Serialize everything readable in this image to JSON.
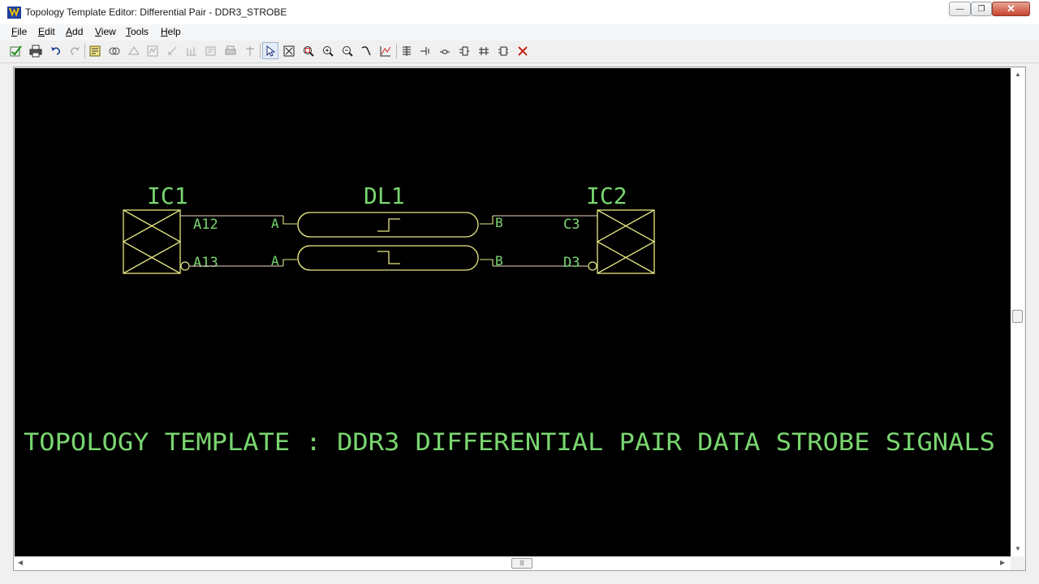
{
  "window": {
    "title": "Topology Template Editor: Differential Pair - DDR3_STROBE",
    "minimize_glyph": "—",
    "restore_glyph": "❐",
    "close_glyph": "✕"
  },
  "menu": {
    "file": {
      "accel": "F",
      "rest": "ile"
    },
    "edit": {
      "accel": "E",
      "rest": "dit"
    },
    "add": {
      "accel": "A",
      "rest": "dd"
    },
    "view": {
      "accel": "V",
      "rest": "iew"
    },
    "tools": {
      "accel": "T",
      "rest": "ools"
    },
    "help": {
      "accel": "H",
      "rest": "elp"
    }
  },
  "toolbar": {
    "icons": [
      "check-net-icon",
      "print-icon",
      "undo-icon",
      "redo-icon",
      "properties-icon",
      "compare-icon",
      "export-icon",
      "waveform-icon",
      "measure-icon",
      "report-icon",
      "print-setup-icon",
      "pin-icon",
      "select-pointer-icon",
      "zoom-fit-icon",
      "zoom-window-icon",
      "zoom-in-icon",
      "zoom-out-icon",
      "wire-tool-icon",
      "graph-icon",
      "add-pin-icon",
      "add-terminator-icon",
      "add-line-icon",
      "add-connector-icon",
      "add-coupled-icon",
      "add-diff-pair-icon",
      "delete-icon"
    ]
  },
  "schematic": {
    "components": {
      "ic1": {
        "ref": "IC1",
        "pins": [
          "A12",
          "A13"
        ]
      },
      "dl1": {
        "ref": "DL1",
        "port_in": [
          "A",
          "A"
        ],
        "port_out": [
          "B",
          "B"
        ]
      },
      "ic2": {
        "ref": "IC2",
        "pins": [
          "C3",
          "D3"
        ]
      }
    },
    "caption": "TOPOLOGY TEMPLATE : DDR3 DIFFERENTIAL PAIR DATA STROBE SIGNALS",
    "colors": {
      "background": "#000000",
      "component": "#e6e683",
      "label": "#79d66f",
      "wire": "#f0d7c8"
    }
  },
  "scrollbars": {
    "up_glyph": "▲",
    "down_glyph": "▼",
    "left_glyph": "◀",
    "right_glyph": "▶",
    "grip_glyph": "|||"
  }
}
